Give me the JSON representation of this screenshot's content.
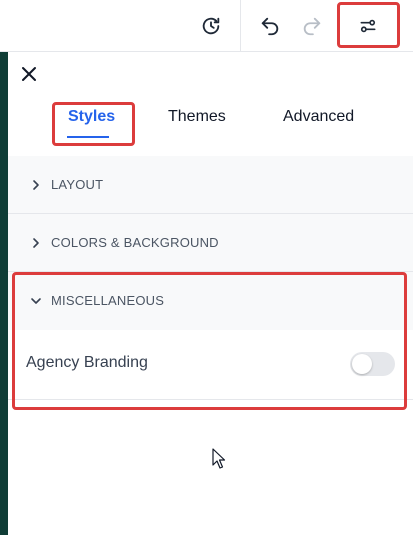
{
  "toolbar": {
    "history_icon": "history-clock-icon",
    "undo_icon": "undo-icon",
    "redo_icon": "redo-icon",
    "settings_icon": "sliders-settings-icon"
  },
  "panel": {
    "close_icon": "close-icon",
    "tabs": [
      {
        "label": "Styles",
        "active": true
      },
      {
        "label": "Themes",
        "active": false
      },
      {
        "label": "Advanced",
        "active": false
      }
    ],
    "sections": [
      {
        "label": "LAYOUT",
        "expanded": false
      },
      {
        "label": "COLORS & BACKGROUND",
        "expanded": false
      },
      {
        "label": "MISCELLANEOUS",
        "expanded": true
      }
    ],
    "misc": {
      "agency_branding_label": "Agency Branding",
      "agency_branding_enabled": false
    }
  },
  "colors": {
    "accent": "#2563eb",
    "highlight": "#dc3c3c",
    "left_strip": "#0f3d36"
  }
}
